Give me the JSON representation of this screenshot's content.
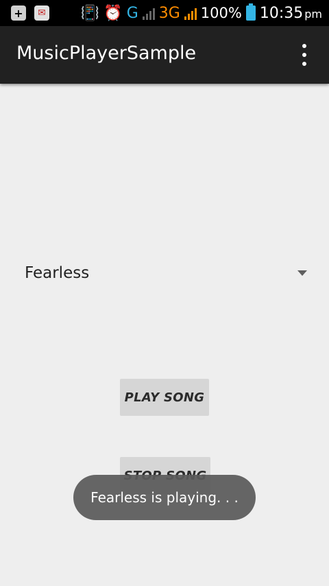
{
  "status_bar": {
    "network_label_1": "G",
    "network_label_2": "3G",
    "battery_percent": "100%",
    "time": "10:35",
    "ampm": "pm",
    "icons": [
      "plus-notification-icon",
      "app-notification-icon",
      "vibrate-icon",
      "alarm-icon",
      "signal-icon",
      "battery-icon"
    ]
  },
  "action_bar": {
    "title": "MusicPlayerSample"
  },
  "spinner": {
    "selected": "Fearless"
  },
  "buttons": {
    "play_label": "PLAY SONG",
    "stop_label": "STOP SONG"
  },
  "toast": {
    "message": "Fearless is playing. . ."
  },
  "colors": {
    "status_bar": "#000000",
    "action_bar": "#212121",
    "background": "#eeeeee",
    "button": "#d6d6d6",
    "accent_blue": "#33b5e5",
    "accent_orange": "#ff8c00"
  }
}
